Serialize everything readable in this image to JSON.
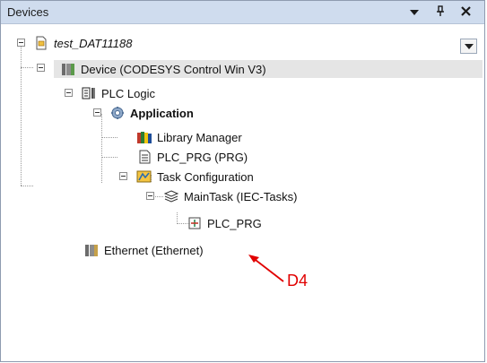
{
  "panel": {
    "title": "Devices",
    "buttons": {
      "dropdown": "▾",
      "pin": "ᵖ",
      "close": "✕"
    }
  },
  "tree": {
    "project": "test_DAT11188",
    "device": "Device (CODESYS Control Win V3)",
    "plc_logic": "PLC Logic",
    "application": "Application",
    "library_manager": "Library Manager",
    "plc_prg_pou": "PLC_PRG (PRG)",
    "task_config": "Task Configuration",
    "main_task": "MainTask (IEC-Tasks)",
    "task_call": "PLC_PRG",
    "ethernet": "Ethernet (Ethernet)"
  },
  "annotation": {
    "label": "D4",
    "color": "#e10000"
  },
  "colors": {
    "titlebar": "#cfdcee",
    "selection": "#e5e5e5"
  }
}
